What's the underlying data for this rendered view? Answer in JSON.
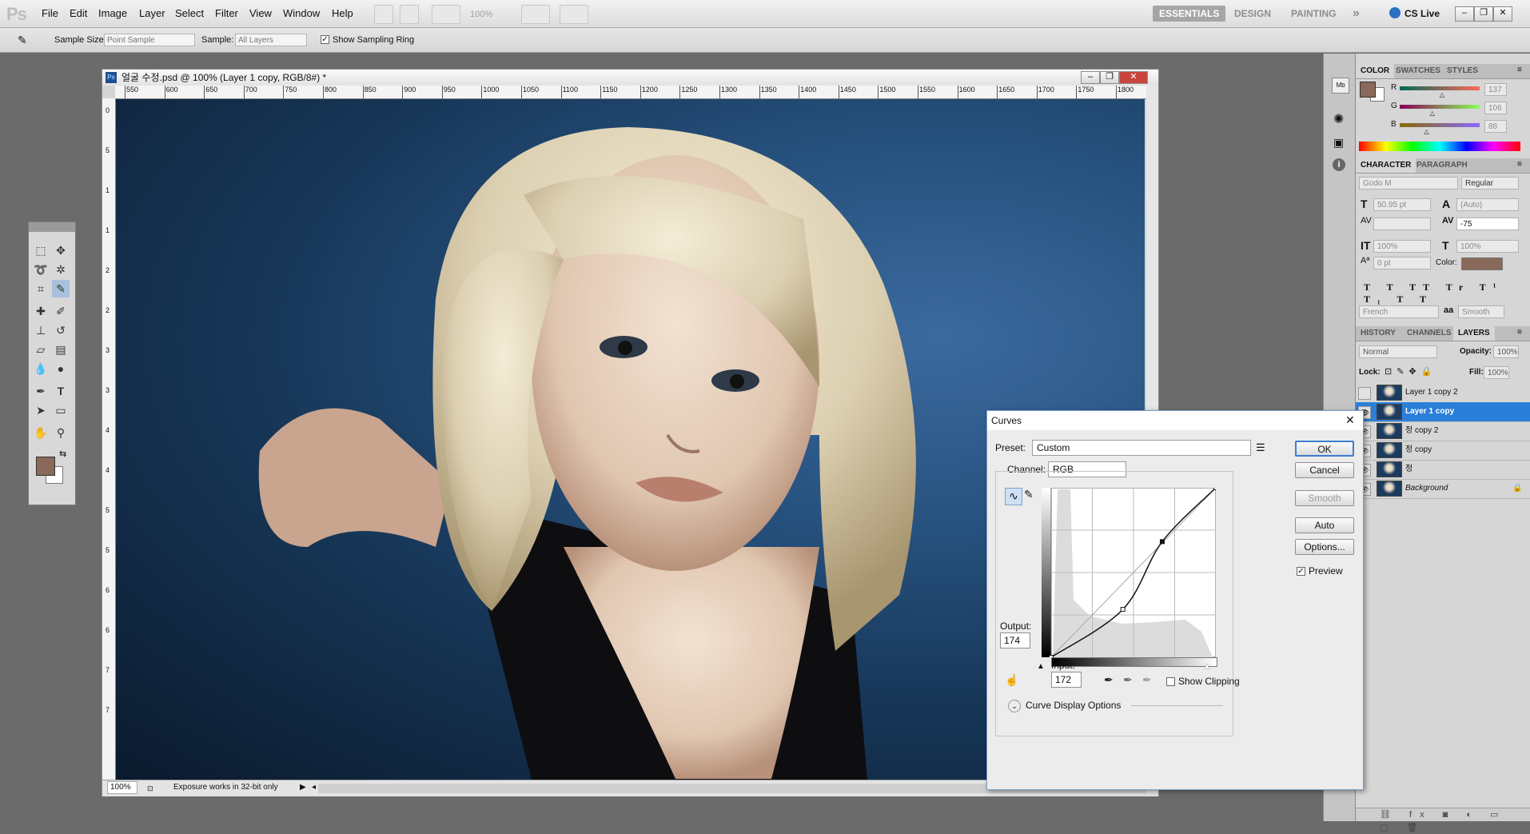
{
  "app": {
    "logo": "Ps"
  },
  "menu": [
    "File",
    "Edit",
    "Image",
    "Layer",
    "Select",
    "Filter",
    "View",
    "Window",
    "Help"
  ],
  "toolbar": {
    "zoom": "100%"
  },
  "workspaces": {
    "essentials": "ESSENTIALS",
    "design": "DESIGN",
    "painting": "PAINTING",
    "more": "»",
    "cslive": "CS Live"
  },
  "options": {
    "sample_size_label": "Sample Size:",
    "sample_size_value": "Point Sample",
    "sample_label": "Sample:",
    "sample_value": "All Layers",
    "ring_label": "Show Sampling Ring",
    "ring_checked": true
  },
  "document": {
    "title": "얼굴 수정.psd @ 100% (Layer 1 copy, RGB/8#) *",
    "ruler_ticks": [
      "550",
      "600",
      "650",
      "700",
      "750",
      "800",
      "850",
      "900",
      "950",
      "1000",
      "1050",
      "1100",
      "1150",
      "1200",
      "1250",
      "1300",
      "1350",
      "1400",
      "1450",
      "1500",
      "1550",
      "1600",
      "1650",
      "1700",
      "1750",
      "1800"
    ],
    "left_ruler_ticks": [
      "0",
      "5",
      "1",
      "1",
      "2",
      "2",
      "3",
      "3",
      "4",
      "4",
      "5",
      "5",
      "6",
      "6",
      "7",
      "7"
    ],
    "status_zoom": "100%",
    "status_text": "Exposure works in 32-bit only"
  },
  "color_panel": {
    "tabs": [
      "COLOR",
      "SWATCHES",
      "STYLES"
    ],
    "r_label": "R",
    "g_label": "G",
    "b_label": "B",
    "r": "137",
    "g": "106",
    "b": "88",
    "r_fraction": 0.537,
    "g_fraction": 0.416,
    "b_fraction": 0.345,
    "foreground": "#89695a"
  },
  "character_panel": {
    "tabs": [
      "CHARACTER",
      "PARAGRAPH"
    ],
    "font": "Godo M",
    "style": "Regular",
    "size": "50.95 pt",
    "leading": "(Auto)",
    "tracking": "-75",
    "vscale": "100%",
    "hscale": "100%",
    "baseline": "0 pt",
    "color_label": "Color:",
    "language": "French",
    "antialias_icon": "aa",
    "antialias": "Smooth"
  },
  "layers_panel": {
    "tabs": [
      "HISTORY",
      "CHANNELS",
      "LAYERS"
    ],
    "blend": "Normal",
    "opacity_label": "Opacity:",
    "opacity": "100%",
    "lock_label": "Lock:",
    "fill_label": "Fill:",
    "fill": "100%",
    "layers": [
      {
        "name": "Layer 1 copy 2",
        "visible": false,
        "selected": false
      },
      {
        "name": "Layer 1 copy",
        "visible": true,
        "selected": true
      },
      {
        "name": "정 copy 2",
        "visible": true,
        "selected": false
      },
      {
        "name": "정 copy",
        "visible": true,
        "selected": false
      },
      {
        "name": "정",
        "visible": true,
        "selected": false
      },
      {
        "name": "Background",
        "visible": true,
        "selected": false
      }
    ]
  },
  "curves": {
    "title": "Curves",
    "preset_label": "Preset:",
    "preset": "Custom",
    "channel_label": "Channel:",
    "channel": "RGB",
    "ok": "OK",
    "cancel": "Cancel",
    "smooth": "Smooth",
    "auto": "Auto",
    "options": "Options...",
    "preview_label": "Preview",
    "preview_checked": true,
    "output_label": "Output:",
    "output": "174",
    "input_label": "Input:",
    "input": "172",
    "show_clipping_label": "Show Clipping",
    "show_clipping_checked": false,
    "display_options_label": "Curve Display Options",
    "close_icon": "✕",
    "points": [
      [
        0,
        0
      ],
      [
        111,
        72
      ],
      [
        172,
        174
      ],
      [
        255,
        255
      ]
    ]
  }
}
